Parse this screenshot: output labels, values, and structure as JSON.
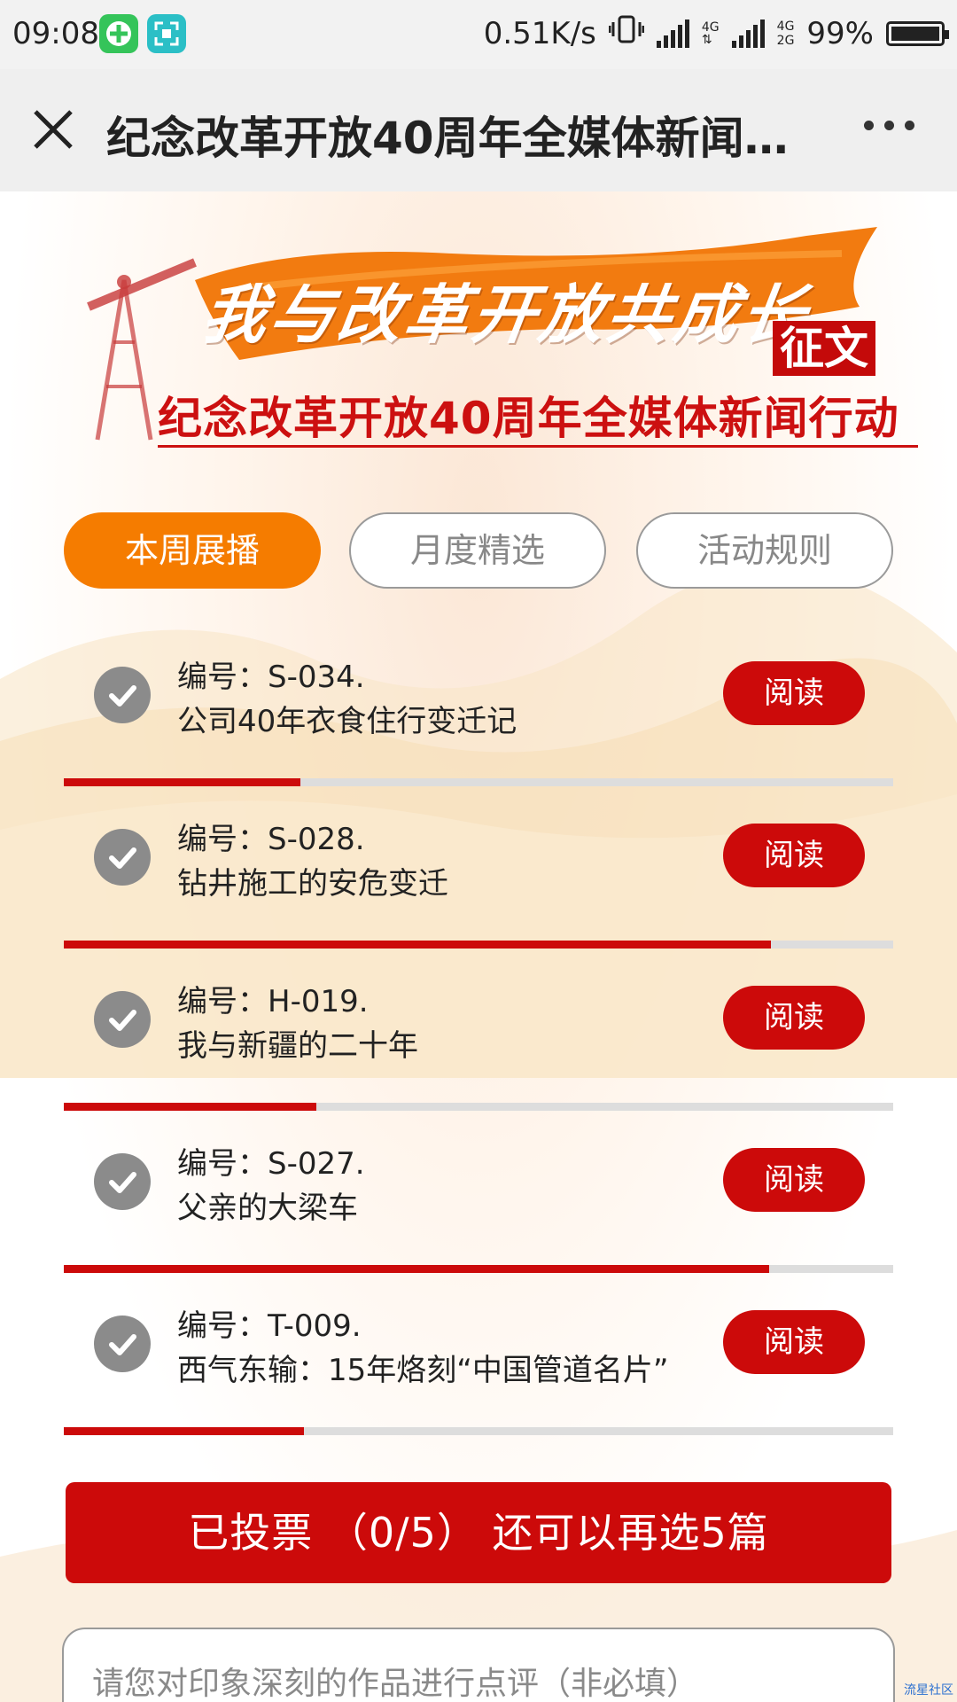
{
  "status_bar": {
    "time": "09:08",
    "net_speed": "0.51K/s",
    "network1": "4G",
    "network2": "4G",
    "network3": "2G",
    "battery": "99%"
  },
  "title_bar": {
    "title": "纪念改革开放40周年全媒体新闻...",
    "close_icon": "close-icon",
    "more_icon": "more-icon"
  },
  "banner": {
    "slogan": "我与改革开放共成长",
    "badge": "征文",
    "subtitle": "纪念改革开放40周年全媒体新闻行动"
  },
  "tabs": [
    {
      "label": "本周展播",
      "active": true
    },
    {
      "label": "月度精选",
      "active": false
    },
    {
      "label": "活动规则",
      "active": false
    }
  ],
  "entries": [
    {
      "number": "编号：S-034.",
      "title": "公司40年衣食住行变迁记",
      "read_label": "阅读",
      "progress": 0.285
    },
    {
      "number": "编号：S-028.",
      "title": "钻井施工的安危变迁",
      "read_label": "阅读",
      "progress": 0.853
    },
    {
      "number": "编号：H-019.",
      "title": "我与新疆的二十年",
      "read_label": "阅读",
      "progress": 0.305
    },
    {
      "number": "编号：S-027.",
      "title": "父亲的大梁车",
      "read_label": "阅读",
      "progress": 0.85
    },
    {
      "number": "编号：T-009.",
      "title": "西气东输：15年烙刻“中国管道名片”",
      "read_label": "阅读",
      "progress": 0.29
    }
  ],
  "vote": {
    "label": "已投票 （0/5） 还可以再选5篇"
  },
  "comment": {
    "placeholder": "请您对印象深刻的作品进行点评（非必填）",
    "value": ""
  },
  "watermark": "流星社区",
  "colors": {
    "accent_red": "#cc0a0a",
    "tab_orange": "#f57c00",
    "check_gray": "#8b8b8b",
    "track_gray": "#dddddd"
  }
}
